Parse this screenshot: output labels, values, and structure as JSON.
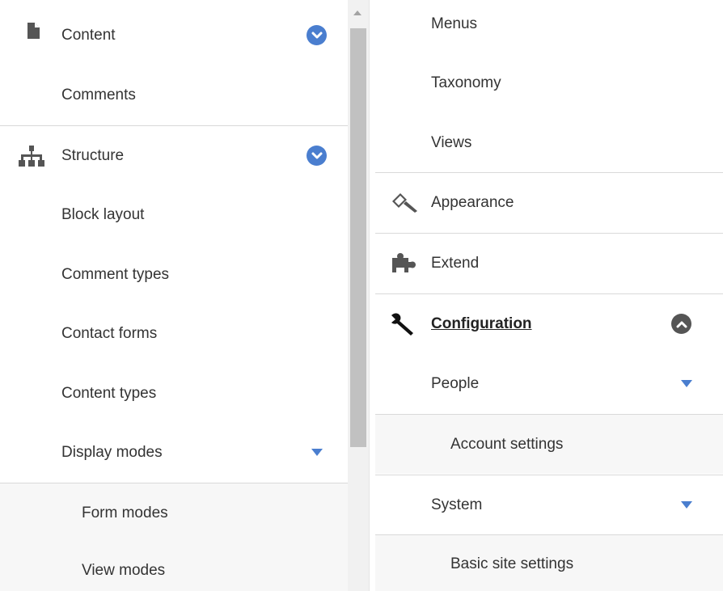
{
  "colors": {
    "accent": "#4a7ecf",
    "active_toggle": "#555555",
    "separator": "#d9d9d9",
    "shaded_row": "#f7f7f7"
  },
  "left_menu": {
    "content": {
      "label": "Content",
      "icon": "file-icon",
      "toggle": "expanded"
    },
    "comments": {
      "label": "Comments"
    },
    "structure": {
      "label": "Structure",
      "icon": "sitemap-icon",
      "toggle": "expanded"
    },
    "block_layout": {
      "label": "Block layout"
    },
    "comment_types": {
      "label": "Comment types"
    },
    "contact_forms": {
      "label": "Contact forms"
    },
    "content_types": {
      "label": "Content types"
    },
    "display_modes": {
      "label": "Display modes"
    },
    "form_modes": {
      "label": "Form modes"
    },
    "view_modes": {
      "label": "View modes"
    }
  },
  "right_menu": {
    "menus": {
      "label": "Menus"
    },
    "taxonomy": {
      "label": "Taxonomy"
    },
    "views": {
      "label": "Views"
    },
    "appearance": {
      "label": "Appearance",
      "icon": "paintbrush-icon"
    },
    "extend": {
      "label": "Extend",
      "icon": "puzzle-icon"
    },
    "configuration": {
      "label": "Configuration",
      "icon": "wrench-icon",
      "toggle": "collapse"
    },
    "people": {
      "label": "People"
    },
    "account_settings": {
      "label": "Account settings"
    },
    "system": {
      "label": "System"
    },
    "basic_site_settings": {
      "label": "Basic site settings"
    }
  }
}
